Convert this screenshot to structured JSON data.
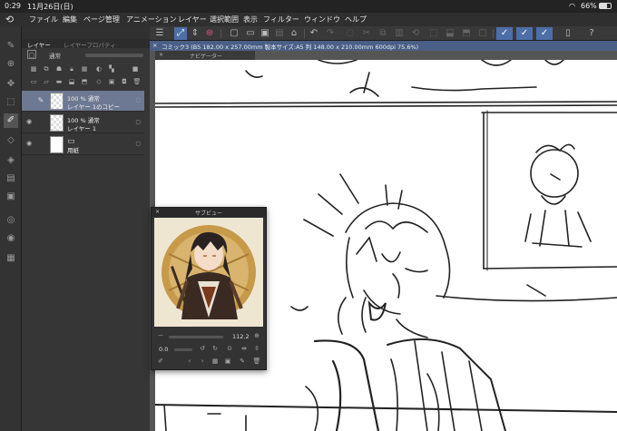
{
  "status": {
    "time": "0:29",
    "date": "11月26日(日)",
    "battery": "66%",
    "wifi_icon": "wifi-icon",
    "battery_icon": "battery-icon"
  },
  "menu": {
    "items": [
      "ファイル",
      "編集",
      "ページ管理",
      "アニメーション",
      "レイヤー",
      "選択範囲",
      "表示",
      "フィルター",
      "ウィンドウ",
      "ヘルプ"
    ],
    "help_icon": "help-icon"
  },
  "document": {
    "title": "コミック3 (B5 182.00 x 257.00mm 製本サイズ:A5 判 148.00 x 210.00mm 600dpi 75.6%)",
    "close": "×"
  },
  "layer_panel": {
    "tabs": [
      "レイヤー",
      "レイヤープロパティ"
    ],
    "blend_mode": "通常",
    "layers": [
      {
        "opacity_mode": "100 % 通常",
        "name": "レイヤー 1のコピー",
        "selected": true
      },
      {
        "opacity_mode": "100 % 通常",
        "name": "レイヤー 1",
        "selected": false
      },
      {
        "opacity_mode": "",
        "name": "用紙",
        "selected": false
      }
    ]
  },
  "navigator": {
    "label": "ナビゲーター",
    "close": "×"
  },
  "subview": {
    "label": "サブビュー",
    "close": "×",
    "zoom": "112.2",
    "angle": "0.0",
    "image_subject": "character-reference-illustration"
  },
  "colors": {
    "accent": "#4d6fa8",
    "doc_tab": "#4a5f86",
    "selected_layer": "#6d7992",
    "panel_bg": "#363636"
  }
}
